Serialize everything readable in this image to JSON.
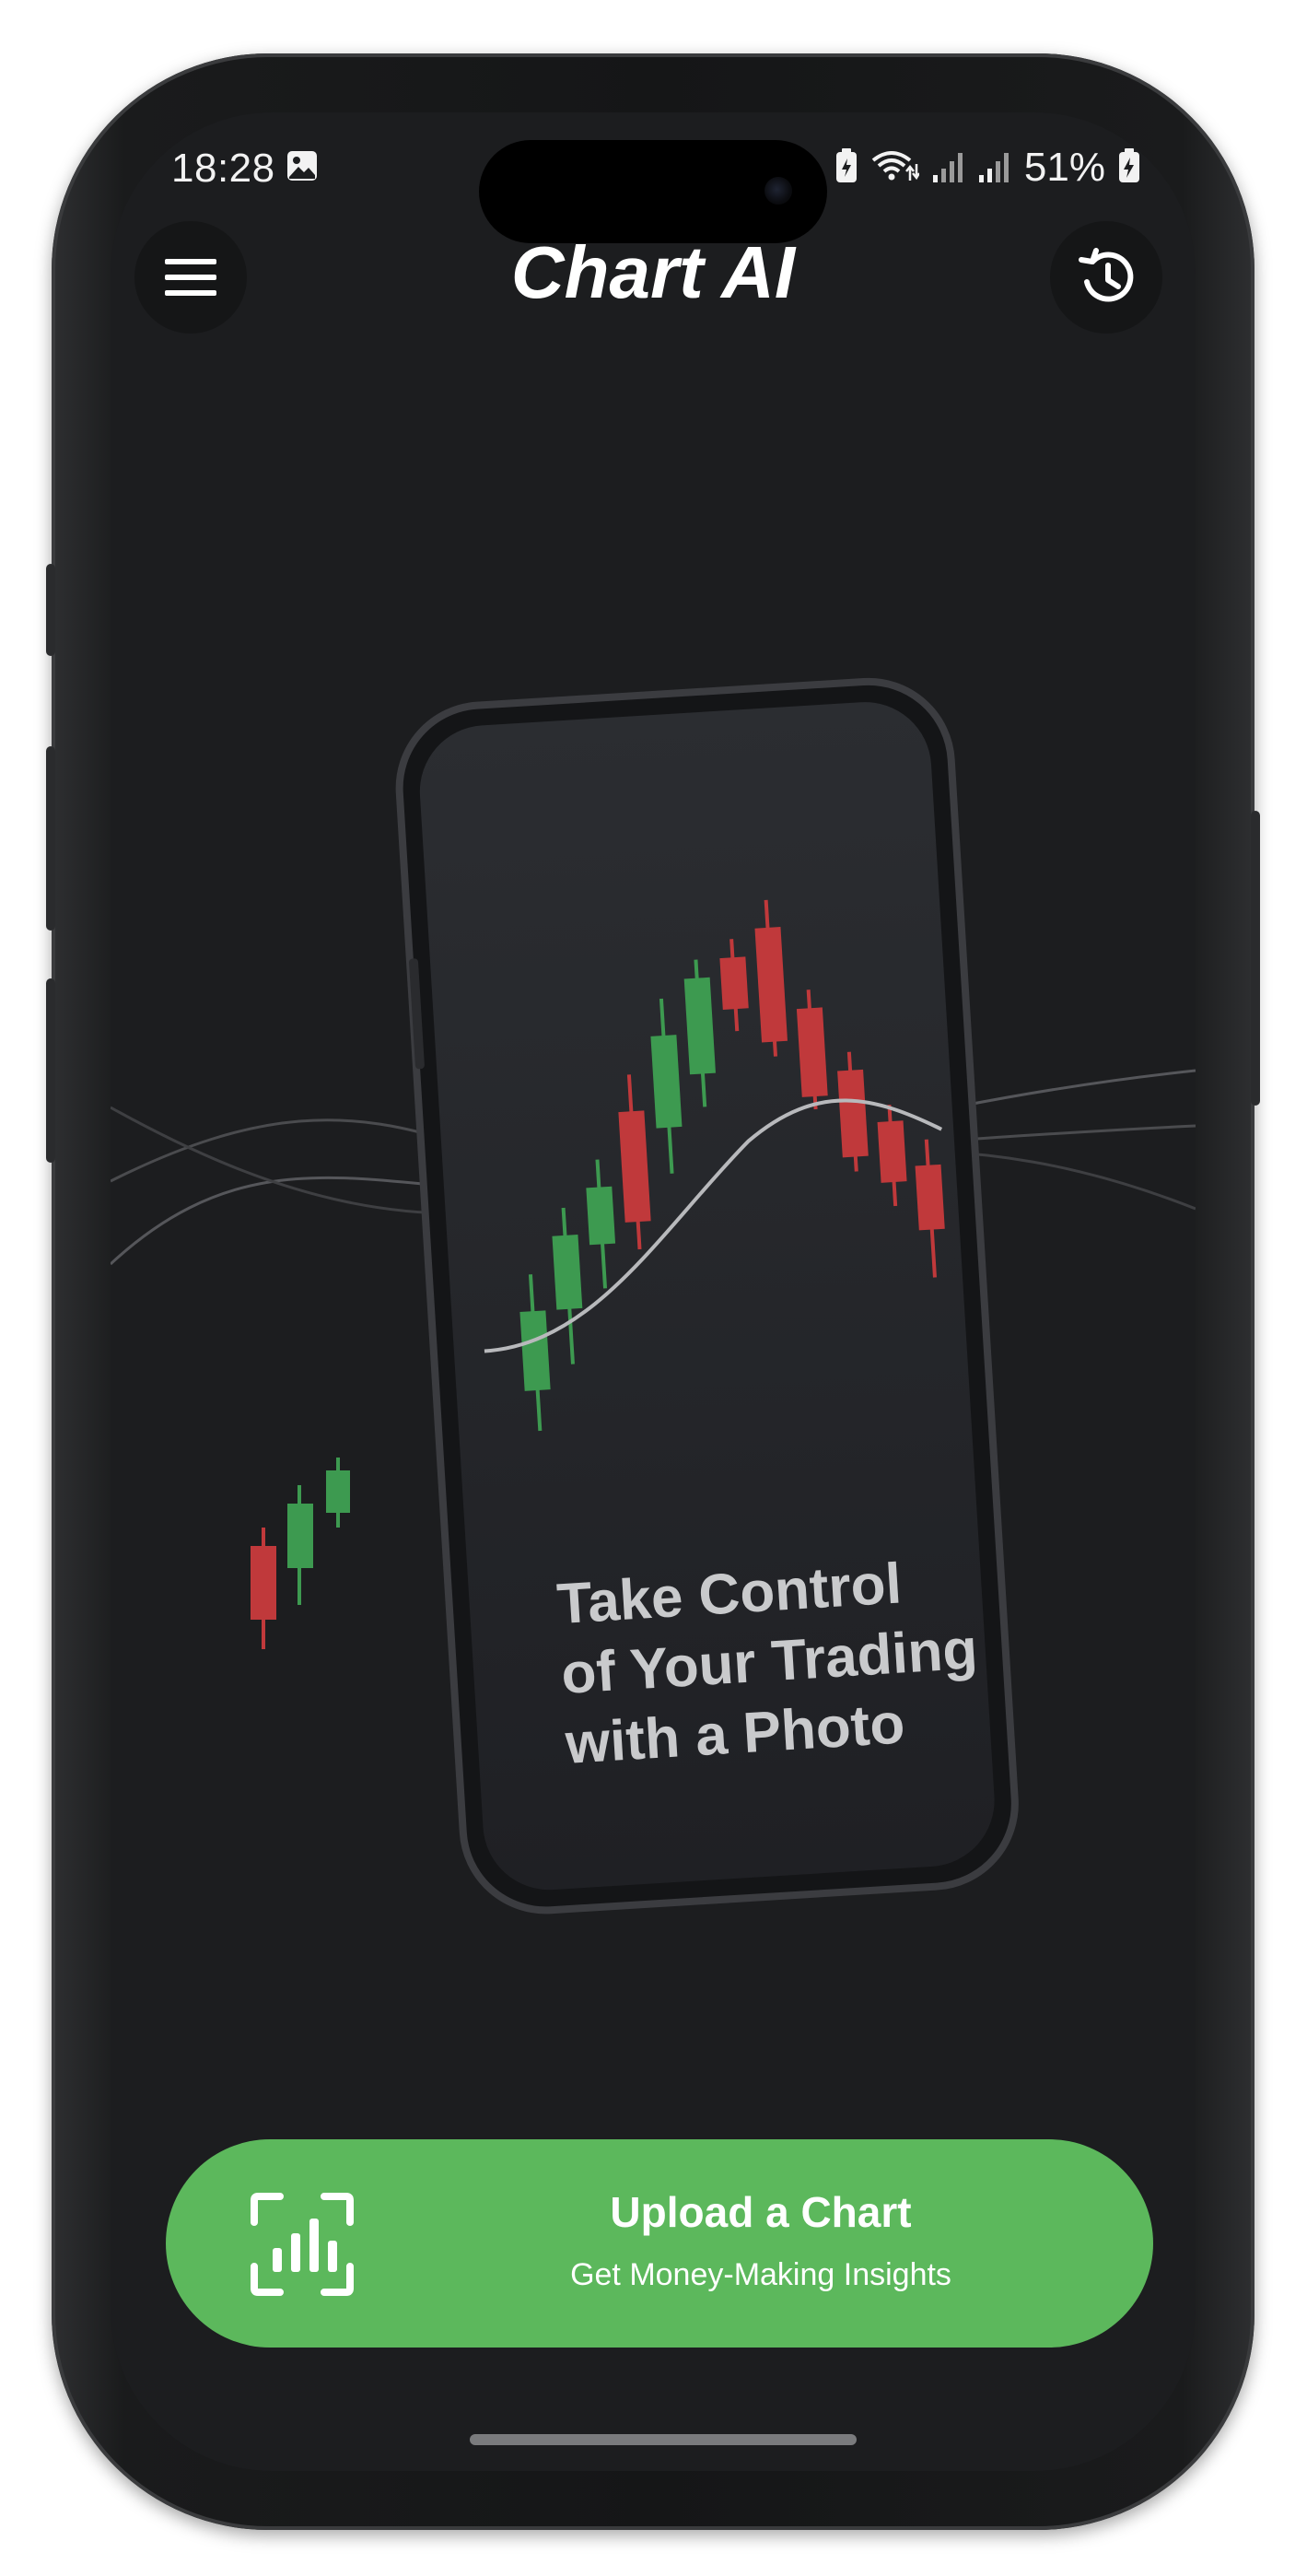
{
  "status_bar": {
    "time": "18:28",
    "battery_percent": "51%",
    "icons": [
      "gallery-icon",
      "battery-saver-icon",
      "wifi-icon",
      "signal-icon",
      "signal-icon",
      "battery-charging-icon"
    ]
  },
  "header": {
    "title": "Chart AI",
    "menu_icon": "menu-icon",
    "history_icon": "history-icon"
  },
  "hero": {
    "headline_lines": [
      "Take Control",
      "of Your Trading",
      "with a Photo"
    ],
    "candle_colors": {
      "up": "#3d9a50",
      "down": "#c0393b"
    }
  },
  "upload": {
    "title": "Upload a Chart",
    "subtitle": "Get Money-Making Insights",
    "icon": "chart-scan-icon",
    "color": "#5cb85c"
  }
}
